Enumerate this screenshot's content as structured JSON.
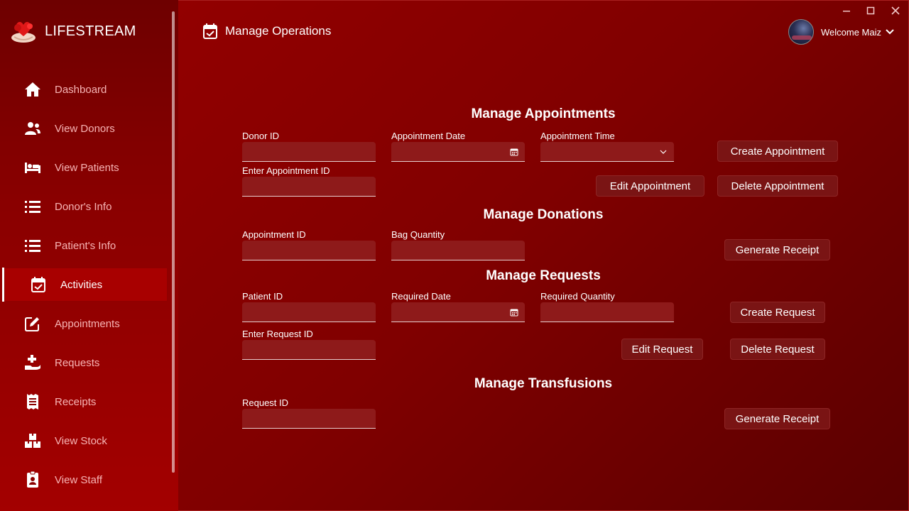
{
  "app": {
    "name": "LIFESTREAM"
  },
  "sidebar": {
    "items": [
      {
        "label": "Dashboard",
        "icon": "home-icon"
      },
      {
        "label": "View Donors",
        "icon": "users-icon"
      },
      {
        "label": "View Patients",
        "icon": "bed-icon"
      },
      {
        "label": "Donor's Info",
        "icon": "list-icon"
      },
      {
        "label": "Patient's Info",
        "icon": "list-icon"
      },
      {
        "label": "Activities",
        "icon": "calendar-check-icon",
        "active": true
      },
      {
        "label": "Appointments",
        "icon": "edit-icon"
      },
      {
        "label": "Requests",
        "icon": "hand-medical-icon"
      },
      {
        "label": "Receipts",
        "icon": "receipt-icon"
      },
      {
        "label": "View Stock",
        "icon": "boxes-icon"
      },
      {
        "label": "View Staff",
        "icon": "id-badge-icon"
      }
    ]
  },
  "header": {
    "title": "Manage Operations",
    "welcome": "Welcome Maiz"
  },
  "appointments": {
    "title": "Manage Appointments",
    "donor_id_label": "Donor ID",
    "date_label": "Appointment Date",
    "time_label": "Appointment Time",
    "enter_id_label": "Enter Appointment ID",
    "create_label": "Create Appointment",
    "edit_label": "Edit Appointment",
    "delete_label": "Delete Appointment"
  },
  "donations": {
    "title": "Manage Donations",
    "appointment_id_label": "Appointment ID",
    "bag_quantity_label": "Bag Quantity",
    "receipt_label": "Generate Receipt"
  },
  "requests": {
    "title": "Manage Requests",
    "patient_id_label": "Patient ID",
    "required_date_label": "Required Date",
    "required_quantity_label": "Required Quantity",
    "enter_id_label": "Enter Request ID",
    "create_label": "Create Request",
    "edit_label": "Edit Request",
    "delete_label": "Delete Request"
  },
  "transfusions": {
    "title": "Manage Transfusions",
    "request_id_label": "Request ID",
    "receipt_label": "Generate Receipt"
  },
  "colors": {
    "sidebar": "#8a0000",
    "main": "#800000",
    "accent": "#a80000"
  }
}
